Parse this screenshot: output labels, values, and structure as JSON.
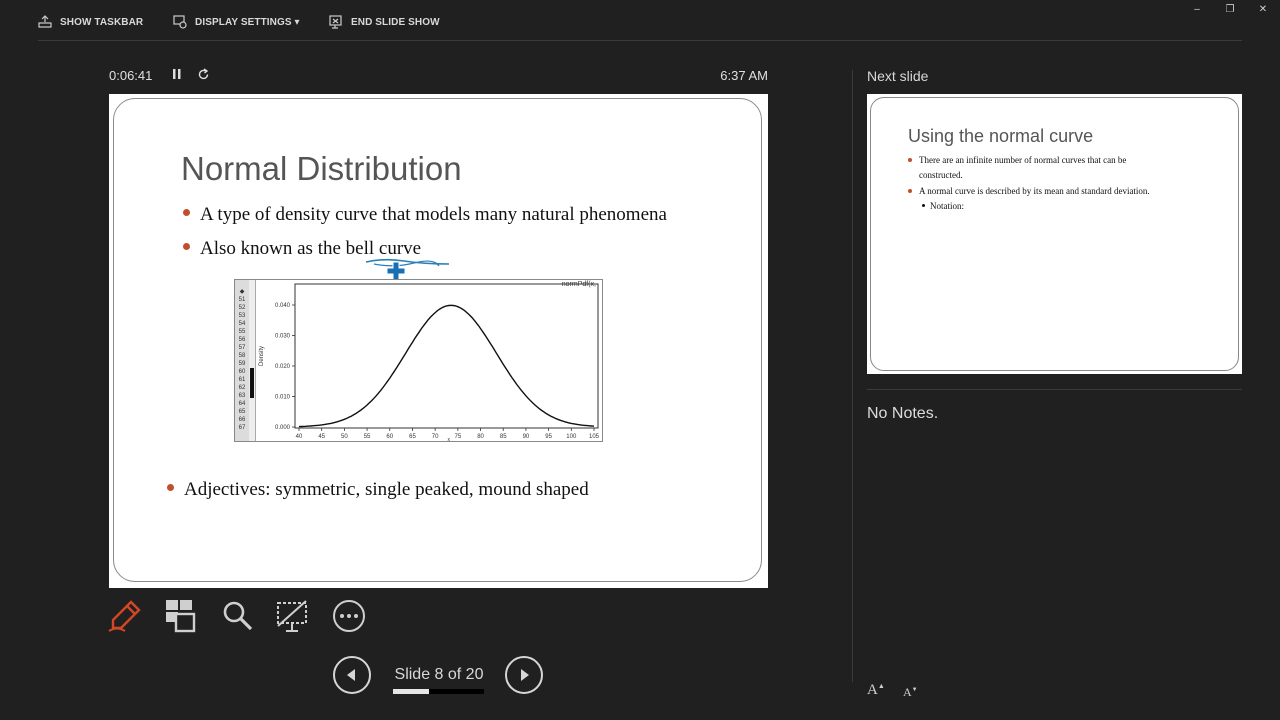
{
  "toolbar": {
    "show_taskbar": "SHOW TASKBAR",
    "display_settings": "DISPLAY SETTINGS ▾",
    "end_slide_show": "END SLIDE SHOW"
  },
  "window_controls": {
    "minimize": "–",
    "restore": "❐",
    "close": "✕"
  },
  "presenter": {
    "timer": "0:06:41",
    "pause_icon": "pause-icon",
    "restart_icon": "restart-icon",
    "clock": "6:37 AM"
  },
  "current_slide": {
    "title": "Normal Distribution",
    "bullets": [
      "A type of density curve that models many natural phenomena",
      "Also known as the bell curve",
      "Adjectives: symmetric, single peaked, mound shaped"
    ],
    "embedded_chart": {
      "corner_label": "normPdf(x,",
      "y_axis_label": "Density",
      "x_axis_label": "x",
      "y_ticks": [
        "0.040",
        "0.030",
        "0.020",
        "0.010",
        "0.000"
      ],
      "x_ticks": [
        "40",
        "45",
        "50",
        "55",
        "60",
        "65",
        "70",
        "75",
        "80",
        "85",
        "90",
        "95",
        "100",
        "105"
      ],
      "row_numbers": [
        "51",
        "52",
        "53",
        "54",
        "55",
        "56",
        "57",
        "58",
        "59",
        "60",
        "61",
        "62",
        "63",
        "64",
        "65",
        "66",
        "67"
      ]
    }
  },
  "next_slide": {
    "label": "Next slide",
    "title": "Using the normal curve",
    "bullets": [
      "There are an infinite number of normal curves that can be",
      "constructed.",
      "A normal curve is described by its mean and standard deviation.",
      "Notation:"
    ]
  },
  "notes": {
    "text": "No Notes."
  },
  "navigation": {
    "slide_counter": "Slide 8 of 20",
    "progress_fraction": 0.4,
    "prev_icon": "previous-slide-icon",
    "next_icon": "next-slide-icon"
  },
  "tools": [
    "pen-icon",
    "see-all-slides-icon",
    "zoom-icon",
    "black-screen-icon",
    "more-options-icon"
  ],
  "font_controls": {
    "increase": "A",
    "decrease": "A"
  },
  "colors": {
    "accent_pen": "#d24726",
    "bullet": "#c0502b",
    "background": "#202020"
  }
}
